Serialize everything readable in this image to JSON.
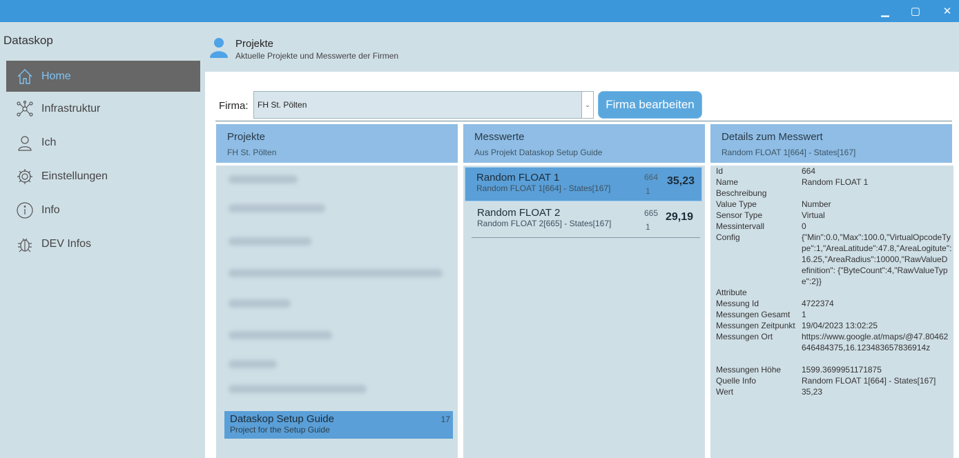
{
  "window": {
    "minimize_icon": "minimize-icon",
    "maximize_icon": "maximize-icon",
    "close_icon": "close-icon",
    "minimize_glyph": "▁",
    "maximize_glyph": "▢",
    "close_glyph": "✕"
  },
  "app": {
    "name": "Dataskop"
  },
  "sidebar": {
    "items": [
      {
        "label": "Home",
        "icon": "home-icon",
        "active": true
      },
      {
        "label": "Infrastruktur",
        "icon": "network-icon"
      },
      {
        "label": "Ich",
        "icon": "user-icon"
      },
      {
        "label": "Einstellungen",
        "icon": "gear-icon"
      },
      {
        "label": "Info",
        "icon": "info-icon"
      },
      {
        "label": "DEV Infos",
        "icon": "bug-icon"
      }
    ]
  },
  "header": {
    "title": "Projekte",
    "subtitle": "Aktuelle Projekte und Messwerte der Firmen",
    "icon": "user-avatar-icon"
  },
  "firma": {
    "label": "Firma:",
    "selected": "FH St. Pölten",
    "chevron": "⌄",
    "edit_button": "Firma bearbeiten"
  },
  "projects": {
    "title": "Projekte",
    "subtitle": "FH St. Pölten",
    "selected_item": {
      "name": "Dataskop Setup Guide",
      "description": "Project for the Setup Guide",
      "count": "17"
    }
  },
  "measurements": {
    "title": "Messwerte",
    "subtitle": "Aus Projekt Dataskop Setup Guide",
    "items": [
      {
        "name": "Random FLOAT 1",
        "desc": "Random FLOAT 1[664] - States[167]",
        "id": "664",
        "count": "1",
        "value": "35,23",
        "selected": true
      },
      {
        "name": "Random FLOAT 2",
        "desc": "Random FLOAT 2[665] - States[167]",
        "id": "665",
        "count": "1",
        "value": "29,19",
        "selected": false
      }
    ]
  },
  "details": {
    "title": "Details zum Messwert",
    "subtitle": "Random FLOAT 1[664] - States[167]",
    "rows": [
      {
        "key": "Id",
        "value": "664"
      },
      {
        "key": "Name",
        "value": "Random FLOAT 1"
      },
      {
        "key": "Beschreibung",
        "value": ""
      },
      {
        "key": "Value Type",
        "value": "Number"
      },
      {
        "key": "Sensor Type",
        "value": "Virtual"
      },
      {
        "key": "Messintervall",
        "value": "0"
      },
      {
        "key": "Config",
        "value": "{\"Min\":0.0,\"Max\":100.0,\"VirtualOpcodeType\":1,\"AreaLatitude\":47.8,\"AreaLogitute\":16.25,\"AreaRadius\":10000,\"RawValueDefinition\": {\"ByteCount\":4,\"RawValueType\":2}}"
      },
      {
        "key": "Attribute",
        "value": ""
      },
      {
        "key": "Messung Id",
        "value": "4722374"
      },
      {
        "key": "Messungen Gesamt",
        "value": "1"
      },
      {
        "key": "Messungen Zeitpunkt",
        "value": "19/04/2023 13:02:25"
      },
      {
        "key": "Messungen Ort",
        "value": "https://www.google.at/maps/@47.80462646484375,16.123483657836914z"
      },
      {
        "key": "Messungen Höhe",
        "value": "1599.3699951171875"
      },
      {
        "key": "Quelle Info",
        "value": "Random FLOAT 1[664] - States[167]"
      },
      {
        "key": "Wert",
        "value": "35,23"
      }
    ]
  }
}
